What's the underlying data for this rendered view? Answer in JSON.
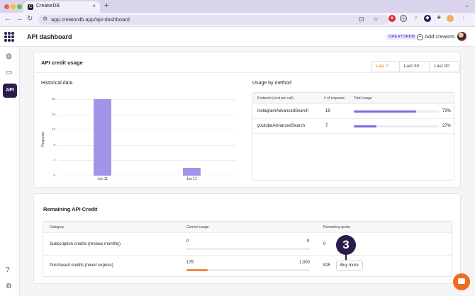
{
  "browser": {
    "tab_title": "CreatorDB",
    "tab_favicon": "C",
    "url": "app.creatordb.app/api-dashboard"
  },
  "header": {
    "title": "API dashboard",
    "brand_badge": "CREATORDB",
    "add_creators_label": "Add creators"
  },
  "sidebar": {
    "api_label": "API"
  },
  "credit_usage": {
    "title": "API credit usage",
    "ranges": [
      "Last 7 days",
      "Last 30 days",
      "Last 90 days"
    ],
    "active_range": "Last 7 days",
    "historical_title": "Historical data",
    "method_title": "Usage by method"
  },
  "chart_data": {
    "type": "bar",
    "title": "Historical data",
    "categories": [
      "Jun 11",
      "Jun 12"
    ],
    "values": [
      20,
      2
    ],
    "ylabel": "Requests",
    "xlabel": "",
    "ylim": [
      0,
      20
    ],
    "yticks": [
      0,
      4,
      8,
      12,
      16,
      20
    ],
    "ytick_labels": [
      "0",
      "4",
      "8",
      "12",
      "16",
      "20"
    ],
    "bar_color": "#a195ea"
  },
  "methods_table": {
    "headers": [
      "Endpoint (cost per call)",
      "# of requests",
      "Total usage"
    ],
    "rows": [
      {
        "endpoint": "instagramAdvancedSearch",
        "requests": "19",
        "usage_pct": "73%",
        "fraction": 0.73
      },
      {
        "endpoint": "youtubeAdvancedSearch",
        "requests": "7",
        "usage_pct": "27%",
        "fraction": 0.27
      }
    ],
    "bar_color": "#7b6be0"
  },
  "remaining": {
    "title": "Remaining API Credit",
    "headers": [
      "Category",
      "Current usage",
      "Remaining quota"
    ],
    "rows": [
      {
        "category": "Subscription credits (renews monthly)",
        "used": "0",
        "limit": "0",
        "remaining": "0",
        "fraction": 0
      },
      {
        "category": "Purchased credits (never expires)",
        "used": "175",
        "limit": "1,000",
        "remaining": "825",
        "fraction": 0.175
      }
    ],
    "buy_more_label": "Buy more",
    "progress_color": "#f28a4a"
  },
  "annotation": {
    "step_number": "3"
  },
  "colors": {
    "accent": "#e8742a",
    "brand_dark": "#2a1d4e",
    "chat": "#f26a21"
  }
}
